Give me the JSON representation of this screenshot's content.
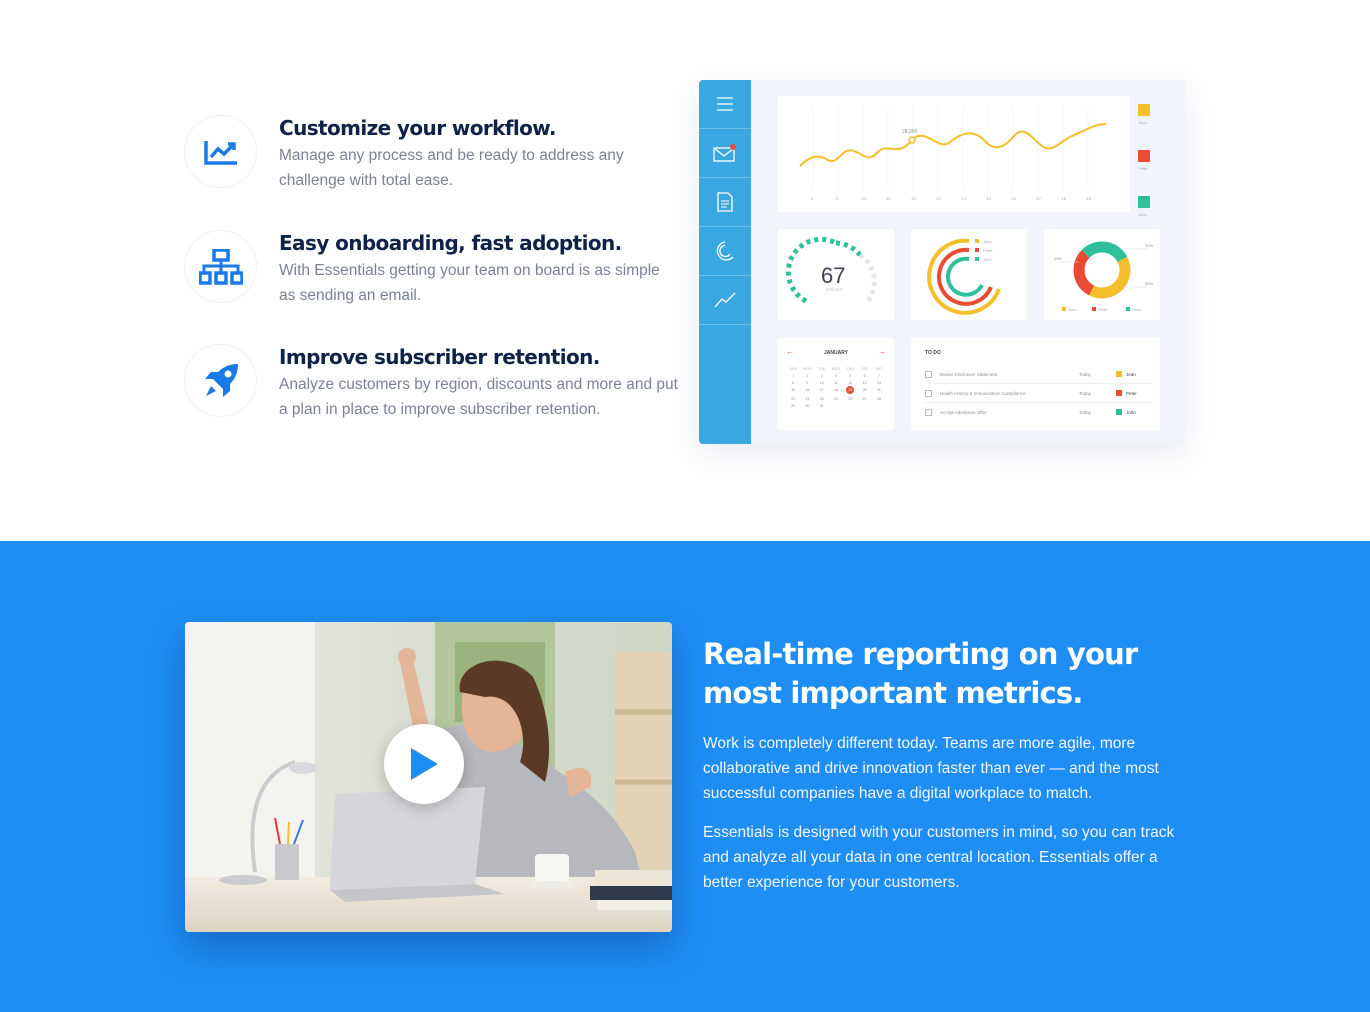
{
  "features": [
    {
      "title": "Customize your workflow.",
      "desc": "Manage any process and be ready to address any challenge with total ease.",
      "icon": "line-chart-icon"
    },
    {
      "title": "Easy onboarding, fast adoption.",
      "desc": "With Essentials getting your team on board is as simple as sending an email.",
      "icon": "sitemap-icon"
    },
    {
      "title": "Improve subscriber retention.",
      "desc": "Analyze customers by region, discounts and more and put a plan in place to improve subscriber retention.",
      "icon": "rocket-icon"
    }
  ],
  "dashboard": {
    "chart_peak": "28,000",
    "x_ticks": [
      "8",
      "9",
      "10",
      "11",
      "12",
      "13",
      "14",
      "15",
      "16",
      "17",
      "18",
      "19"
    ],
    "legend": [
      "Jean",
      "Peter",
      "John"
    ],
    "gauge_value": "67",
    "gauge_label": "PERCENT",
    "donut_labels": [
      "30%",
      "20%",
      "30%"
    ],
    "calendar_month": "JANUARY",
    "weekdays": [
      "SUN",
      "MON",
      "TUE",
      "WED",
      "THU",
      "FRI",
      "SAT"
    ],
    "days": [
      "1",
      "2",
      "3",
      "4",
      "5",
      "6",
      "7",
      "8",
      "9",
      "10",
      "11",
      "12",
      "13",
      "14",
      "15",
      "16",
      "17",
      "18",
      "19",
      "20",
      "21",
      "22",
      "23",
      "24",
      "25",
      "26",
      "27",
      "28",
      "29",
      "30",
      "31"
    ],
    "todo_title": "TO DO",
    "todos": [
      {
        "task": "Bursar Disclosure Statement",
        "when": "Today",
        "who": "Jean"
      },
      {
        "task": "Health History & Immunization Compliance",
        "when": "Today",
        "who": "Peter"
      },
      {
        "task": "Accept Admission Offer",
        "when": "Today",
        "who": "John"
      }
    ]
  },
  "colors": {
    "accent": "#1e8ef5",
    "sidebar": "#3aa8e0",
    "yellow": "#f4bf2a",
    "red": "#ea4b35",
    "green": "#2fbf9a"
  },
  "reporting": {
    "heading": "Real-time reporting on your most important metrics.",
    "para1": "Work is completely different today. Teams are more agile, more collaborative and drive innovation faster than ever — and the most successful companies have a digital workplace to match.",
    "para2": "Essentials is designed with your customers in mind, so you can track and analyze all your data in one central location. Essentials offer a better experience for your customers."
  }
}
